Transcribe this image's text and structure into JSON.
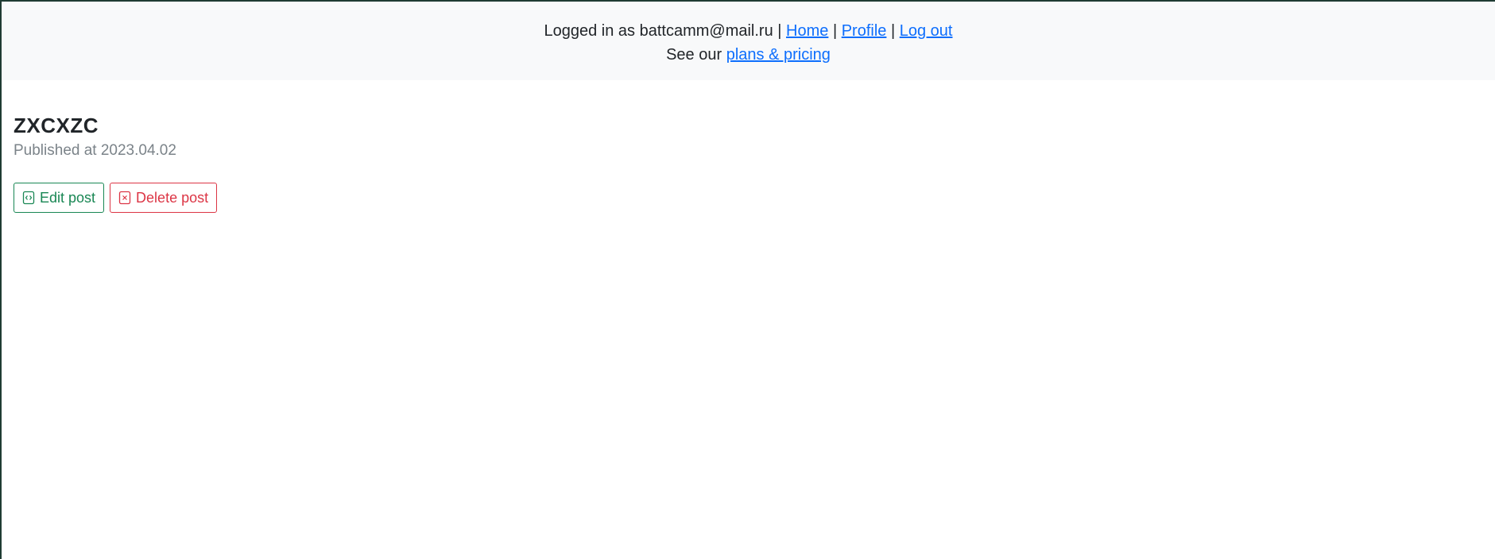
{
  "header": {
    "logged_in_prefix": "Logged in as battcamm@mail.ru |",
    "home_link": "Home",
    "separator_1": "|",
    "profile_link": "Profile",
    "separator_2": "|",
    "logout_link": "Log out",
    "plans_prefix": "See our",
    "plans_link": "plans & pricing"
  },
  "post": {
    "title": "ZXCXZC",
    "published": "Published at 2023.04.02"
  },
  "actions": {
    "edit_label": "Edit post",
    "edit_icon": "file-code-icon",
    "delete_label": "Delete post",
    "delete_icon": "file-x-icon"
  },
  "colors": {
    "header_bg": "#f8f9fa",
    "link": "#0d6efd",
    "edit": "#198754",
    "delete": "#dc3545",
    "muted": "#7b8389"
  }
}
